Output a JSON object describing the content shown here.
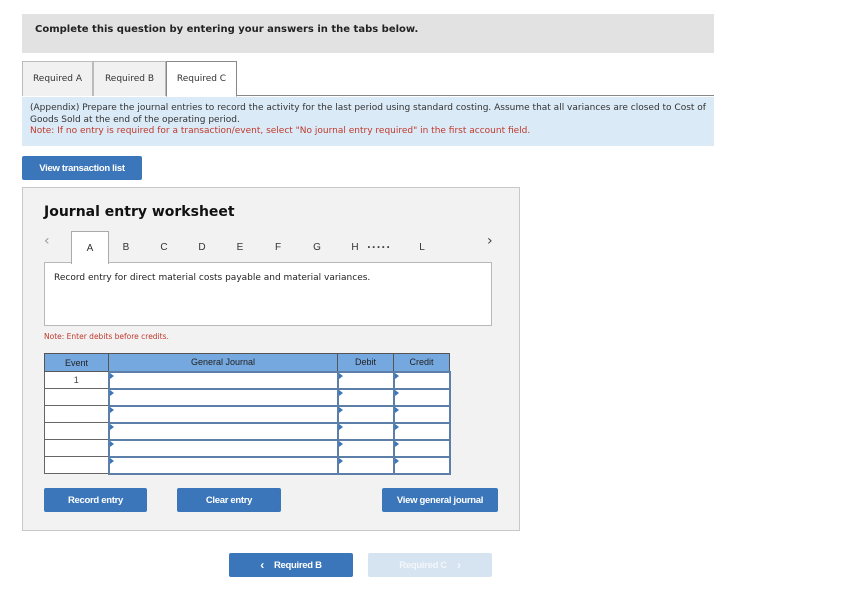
{
  "header": {
    "text": "Complete this question by entering your answers in the tabs below."
  },
  "tabs": [
    {
      "label": "Required A",
      "active": false
    },
    {
      "label": "Required B",
      "active": false
    },
    {
      "label": "Required C",
      "active": true
    }
  ],
  "instructions": {
    "text": "(Appendix) Prepare the journal entries to record the activity for the last period using standard costing. Assume that all variances are closed to Cost of Goods Sold at the end of the operating period.",
    "note": "Note: If no entry is required for a transaction/event, select \"No journal entry required\" in the first account field."
  },
  "view_transaction_list_label": "View transaction list",
  "worksheet": {
    "title": "Journal entry worksheet",
    "letters": [
      "A",
      "B",
      "C",
      "D",
      "E",
      "F",
      "G",
      "H",
      "L"
    ],
    "active_letter": "A",
    "ellipsis": ".....",
    "description": "Record entry for direct material costs payable and material variances.",
    "debit_note": "Note: Enter debits before credits.",
    "table": {
      "headers": {
        "event": "Event",
        "general_journal": "General Journal",
        "debit": "Debit",
        "credit": "Credit"
      },
      "rows": [
        {
          "event": "1",
          "account": "",
          "debit": "",
          "credit": ""
        },
        {
          "event": "",
          "account": "",
          "debit": "",
          "credit": ""
        },
        {
          "event": "",
          "account": "",
          "debit": "",
          "credit": ""
        },
        {
          "event": "",
          "account": "",
          "debit": "",
          "credit": ""
        },
        {
          "event": "",
          "account": "",
          "debit": "",
          "credit": ""
        },
        {
          "event": "",
          "account": "",
          "debit": "",
          "credit": ""
        }
      ]
    },
    "buttons": {
      "record": "Record entry",
      "clear": "Clear entry",
      "view_general_journal": "View general journal"
    }
  },
  "bottom_nav": {
    "prev_label": "Required B",
    "next_label": "Required C",
    "prev_icon": "chevron-left-icon",
    "next_icon": "chevron-right-icon"
  },
  "colors": {
    "primary_button": "#3b76ba",
    "disabled_button": "#d6e3f0",
    "table_header": "#75a8df",
    "note_red": "#c0392b",
    "instructions_bg": "#daeaf7"
  }
}
